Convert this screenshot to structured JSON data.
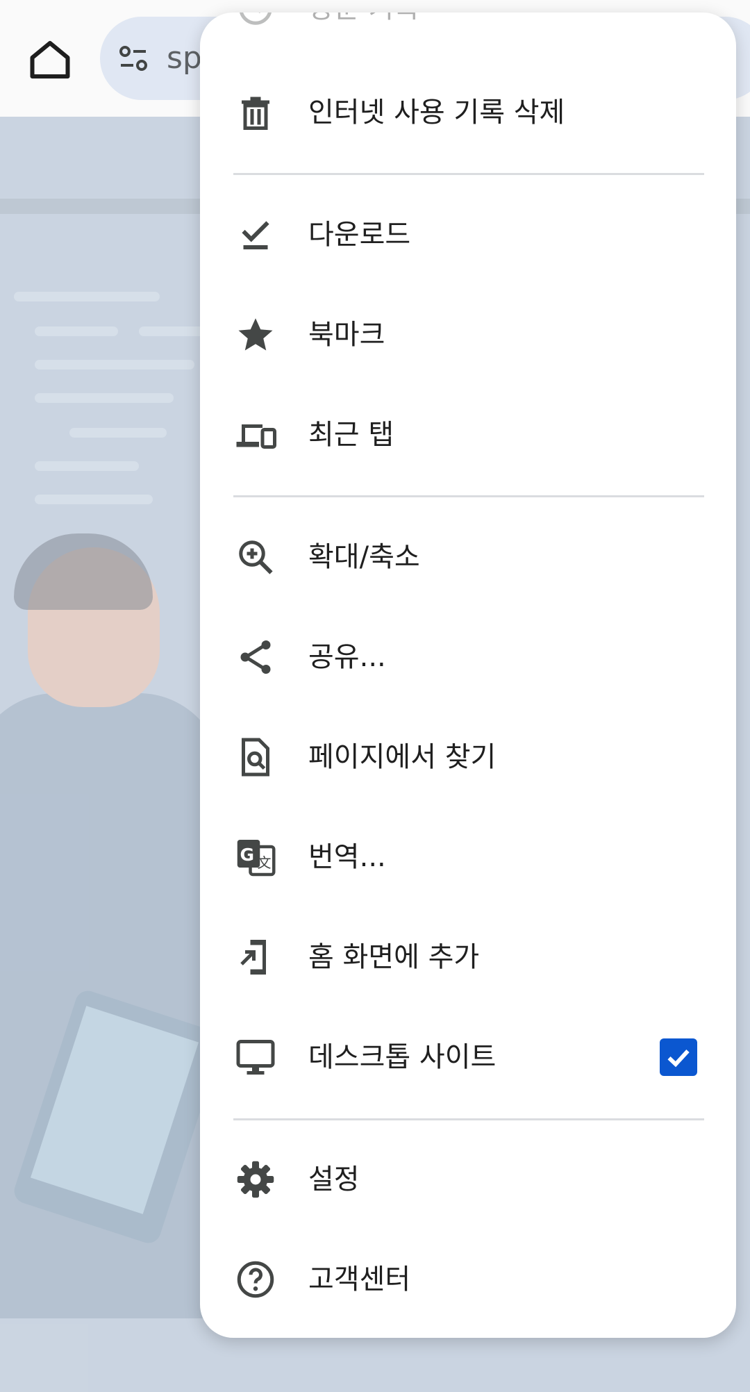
{
  "toolbar": {
    "home_icon": "home-icon",
    "omnibox_icon": "tune-icon",
    "omnibox_text": "spe"
  },
  "menu": {
    "items": [
      {
        "id": "history",
        "label": "방문 기록",
        "icon": "history-icon"
      },
      {
        "id": "clear-browsing-data",
        "label": "인터넷 사용 기록 삭제",
        "icon": "trash-icon"
      },
      {
        "id": "downloads",
        "label": "다운로드",
        "icon": "download-check-icon"
      },
      {
        "id": "bookmarks",
        "label": "북마크",
        "icon": "star-icon"
      },
      {
        "id": "recent-tabs",
        "label": "최근 탭",
        "icon": "devices-icon"
      },
      {
        "id": "zoom",
        "label": "확대/축소",
        "icon": "zoom-in-icon"
      },
      {
        "id": "share",
        "label": "공유...",
        "icon": "share-icon"
      },
      {
        "id": "find-in-page",
        "label": "페이지에서 찾기",
        "icon": "find-in-page-icon"
      },
      {
        "id": "translate",
        "label": "번역...",
        "icon": "translate-icon"
      },
      {
        "id": "add-to-home",
        "label": "홈 화면에 추가",
        "icon": "add-to-home-icon"
      },
      {
        "id": "desktop-site",
        "label": "데스크톱 사이트",
        "icon": "desktop-icon",
        "checked": true
      },
      {
        "id": "settings",
        "label": "설정",
        "icon": "gear-icon"
      },
      {
        "id": "help",
        "label": "고객센터",
        "icon": "help-icon"
      }
    ]
  },
  "colors": {
    "accent": "#0b57d0",
    "icon": "#444746",
    "text": "#1f1f1f"
  }
}
